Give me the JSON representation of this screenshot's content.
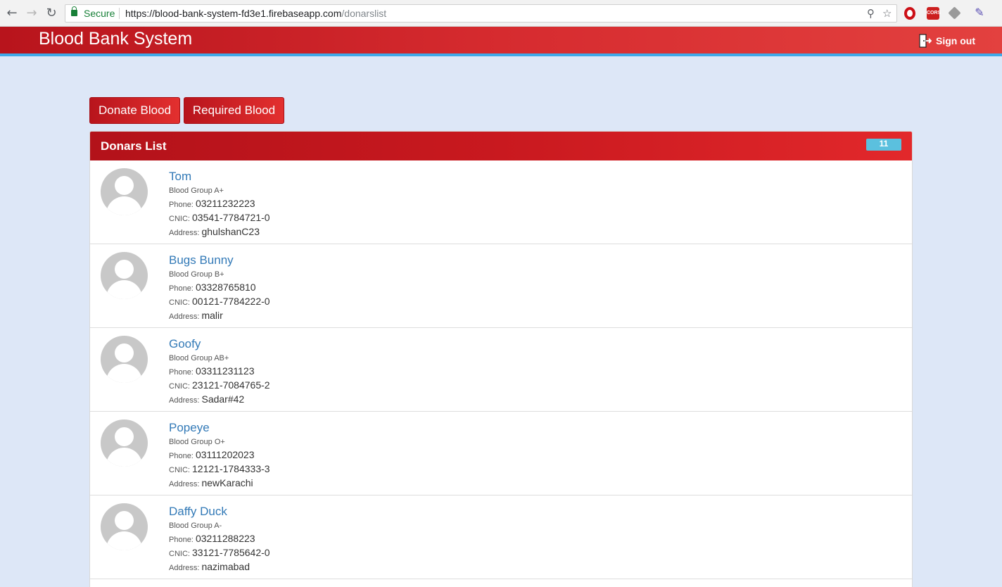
{
  "browser": {
    "secure_label": "Secure",
    "url_host": "https://blood-bank-system-fd3e1.firebaseapp.com",
    "url_path": "/donarslist",
    "extensions": [
      "opera-icon",
      "cors-icon",
      "gem-icon",
      "picker-icon"
    ],
    "cors_label": "CORS"
  },
  "header": {
    "brand": "Blood Bank System",
    "signout_label": "Sign out"
  },
  "actions": {
    "donate_label": "Donate Blood",
    "required_label": "Required Blood"
  },
  "panel": {
    "title": "Donars List",
    "count": "11"
  },
  "labels": {
    "blood_group": "Blood Group",
    "phone": "Phone:",
    "cnic": "CNIC:",
    "address": "Address:"
  },
  "donors": [
    {
      "name": "Tom",
      "blood_group": "A+",
      "phone": "03211232223",
      "cnic": "03541-7784721-0",
      "address": "ghulshanC23"
    },
    {
      "name": "Bugs Bunny",
      "blood_group": "B+",
      "phone": "03328765810",
      "cnic": "00121-7784222-0",
      "address": "malir"
    },
    {
      "name": "Goofy",
      "blood_group": "AB+",
      "phone": "03311231123",
      "cnic": "23121-7084765-2",
      "address": "Sadar#42"
    },
    {
      "name": "Popeye",
      "blood_group": "O+",
      "phone": "03111202023",
      "cnic": "12121-1784333-3",
      "address": "newKarachi"
    },
    {
      "name": "Daffy Duck",
      "blood_group": "A-",
      "phone": "03211288223",
      "cnic": "33121-7785642-0",
      "address": "nazimabad"
    }
  ],
  "colors": {
    "brand_red": "#c9191f",
    "accent_blue": "#3fa9e8",
    "badge": "#5bc0de",
    "link": "#337ab7"
  }
}
